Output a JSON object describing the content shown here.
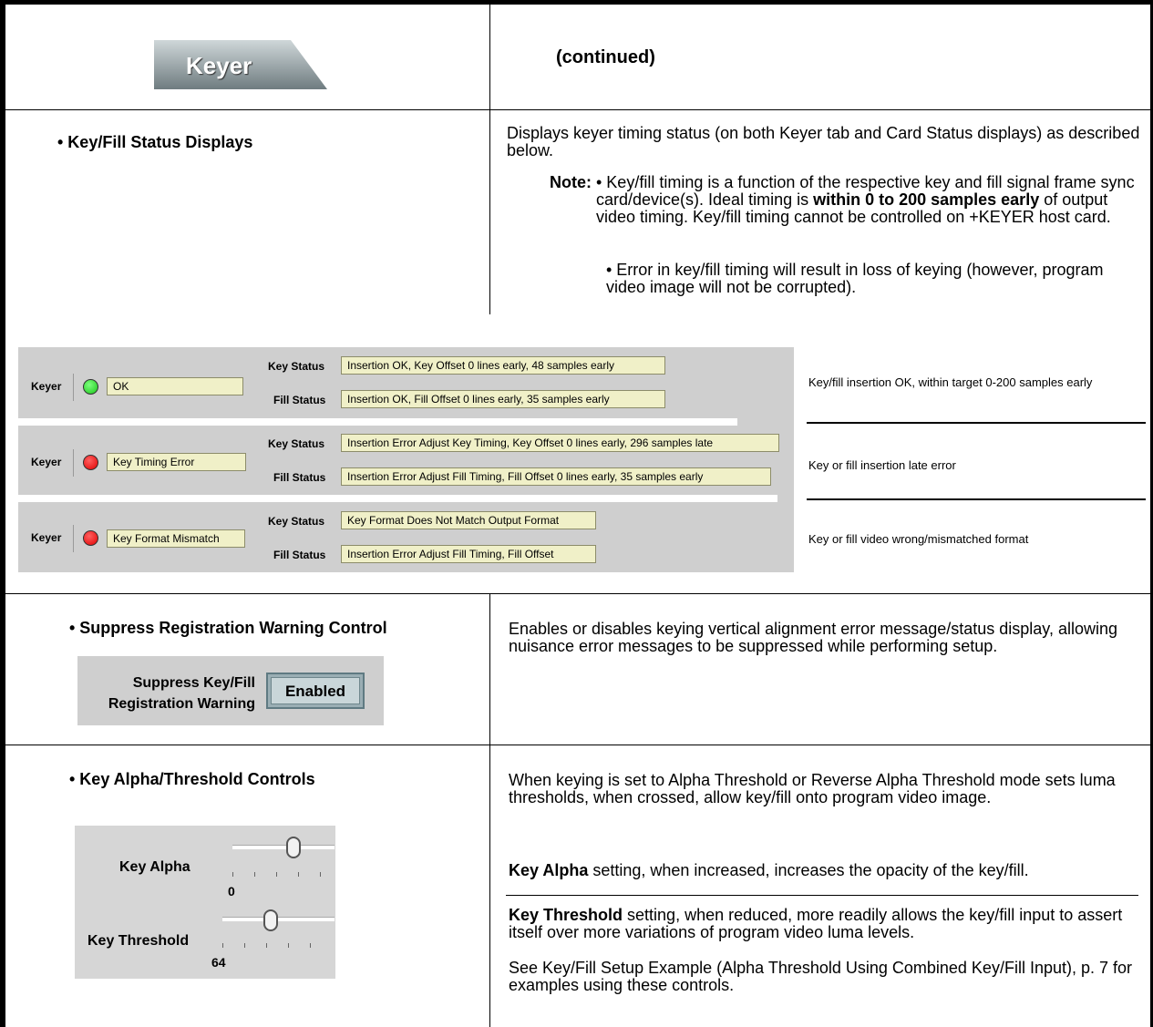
{
  "header": {
    "tab_label": "Keyer",
    "continued": "(continued)"
  },
  "status_section": {
    "title": "• Key/Fill Status Displays",
    "description": "Displays keyer timing status (on both Keyer tab and Card Status displays) as described below.",
    "note_label": "Note:",
    "note1_pre": "• Key/fill timing is a function of the respective key and fill signal frame sync card/device(s). Ideal timing is ",
    "note1_bold": "within 0 to 200 samples early",
    "note1_post": " of output video timing. Key/fill timing cannot be controlled on +KEYER host card.",
    "note2": "• Error in key/fill timing will result in loss of keying (however, program video image will not be corrupted)."
  },
  "status_panel": {
    "keyer_label": "Keyer",
    "key_status_label": "Key Status",
    "fill_status_label": "Fill Status",
    "rows": [
      {
        "led": "green",
        "state": "OK",
        "key_status": "Insertion OK, Key Offset 0 lines early, 48 samples early",
        "fill_status": "Insertion OK, Fill Offset 0 lines early, 35 samples early",
        "caption": "Key/fill insertion OK, within target 0-200 samples early"
      },
      {
        "led": "red",
        "state": "Key Timing Error",
        "key_status": "Insertion Error Adjust Key Timing, Key Offset 0 lines early, 296 samples late",
        "fill_status": "Insertion Error Adjust Fill Timing, Fill Offset 0 lines early, 35 samples early",
        "caption": "Key or fill insertion late error"
      },
      {
        "led": "red",
        "state": "Key Format Mismatch",
        "key_status": "Key Format Does Not Match Output Format",
        "fill_status": "Insertion Error Adjust Fill Timing, Fill Offset",
        "caption": "Key or fill video wrong/mismatched format"
      }
    ],
    "colors": {
      "green": "#19c619",
      "red": "#e00000",
      "panel_bg": "#cfcfcf",
      "field_bg": "#f0f0c8"
    }
  },
  "suppress_section": {
    "title": "• Suppress Registration Warning Control",
    "control_label_line1": "Suppress Key/Fill",
    "control_label_line2": "Registration Warning",
    "button_label": "Enabled",
    "description": "Enables or disables keying vertical alignment error message/status display, allowing nuisance error messages to be suppressed while performing setup."
  },
  "alpha_section": {
    "title": "• Key Alpha/Threshold Controls",
    "key_alpha_label": "Key Alpha",
    "key_alpha_value": "0",
    "key_threshold_label": "Key Threshold",
    "key_threshold_value": "64",
    "desc1": "When keying is set to Alpha Threshold or Reverse Alpha Threshold mode sets luma thresholds, when crossed, allow key/fill onto program video image.",
    "desc2_bold": "Key Alpha",
    "desc2_rest": " setting, when increased, increases the opacity of the key/fill.",
    "desc3_bold": "Key Threshold",
    "desc3_rest": " setting, when reduced, more readily allows the key/fill input to assert itself over more variations of program video luma levels.",
    "desc4": "See Key/Fill Setup Example (Alpha Threshold Using Combined Key/Fill Input), p. 7 for examples using these controls."
  }
}
